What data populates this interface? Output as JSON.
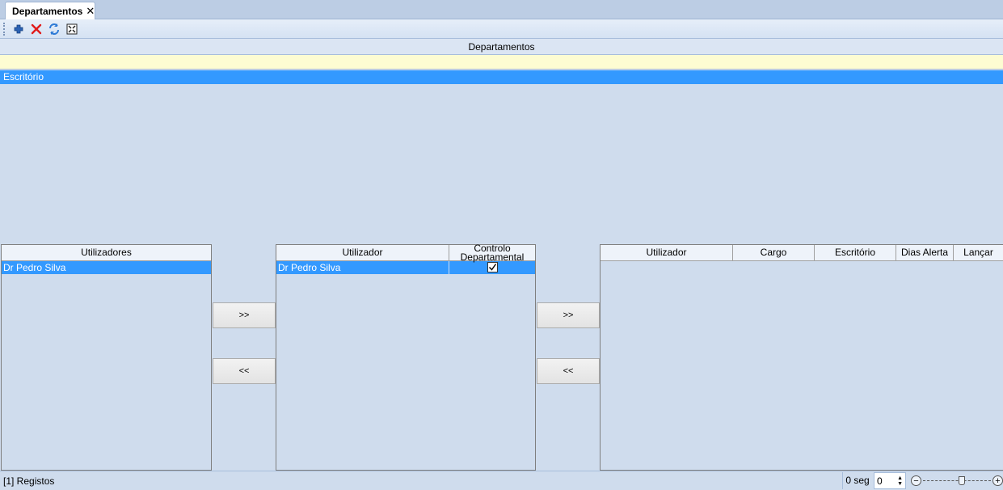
{
  "tab": {
    "title": "Departamentos",
    "close_glyph": "✕"
  },
  "toolbar": {
    "icons": [
      "add-icon",
      "delete-icon",
      "refresh-icon",
      "fit-icon"
    ]
  },
  "section": {
    "title": "Departamentos"
  },
  "departments": [
    {
      "name": "Escritório",
      "selected": true
    }
  ],
  "users_grid": {
    "header": "Utilizadores",
    "rows": [
      "Dr Pedro Silva"
    ]
  },
  "assigned_grid": {
    "headers": [
      "Utilizador",
      "Controlo Departamental"
    ],
    "rows": [
      {
        "user": "Dr Pedro Silva",
        "controlo": true
      }
    ]
  },
  "transfer_buttons": {
    "add": ">>",
    "remove": "<<"
  },
  "details_grid": {
    "headers": [
      "Utilizador",
      "Cargo",
      "Escritório",
      "Dias Alerta",
      "Lançar"
    ]
  },
  "statusbar": {
    "records": "[1] Registos",
    "time": "0 seg",
    "spinner_value": "0"
  },
  "colors": {
    "selection": "#3399ff",
    "background": "#cfdced",
    "filter_row": "#fdfcd2"
  }
}
